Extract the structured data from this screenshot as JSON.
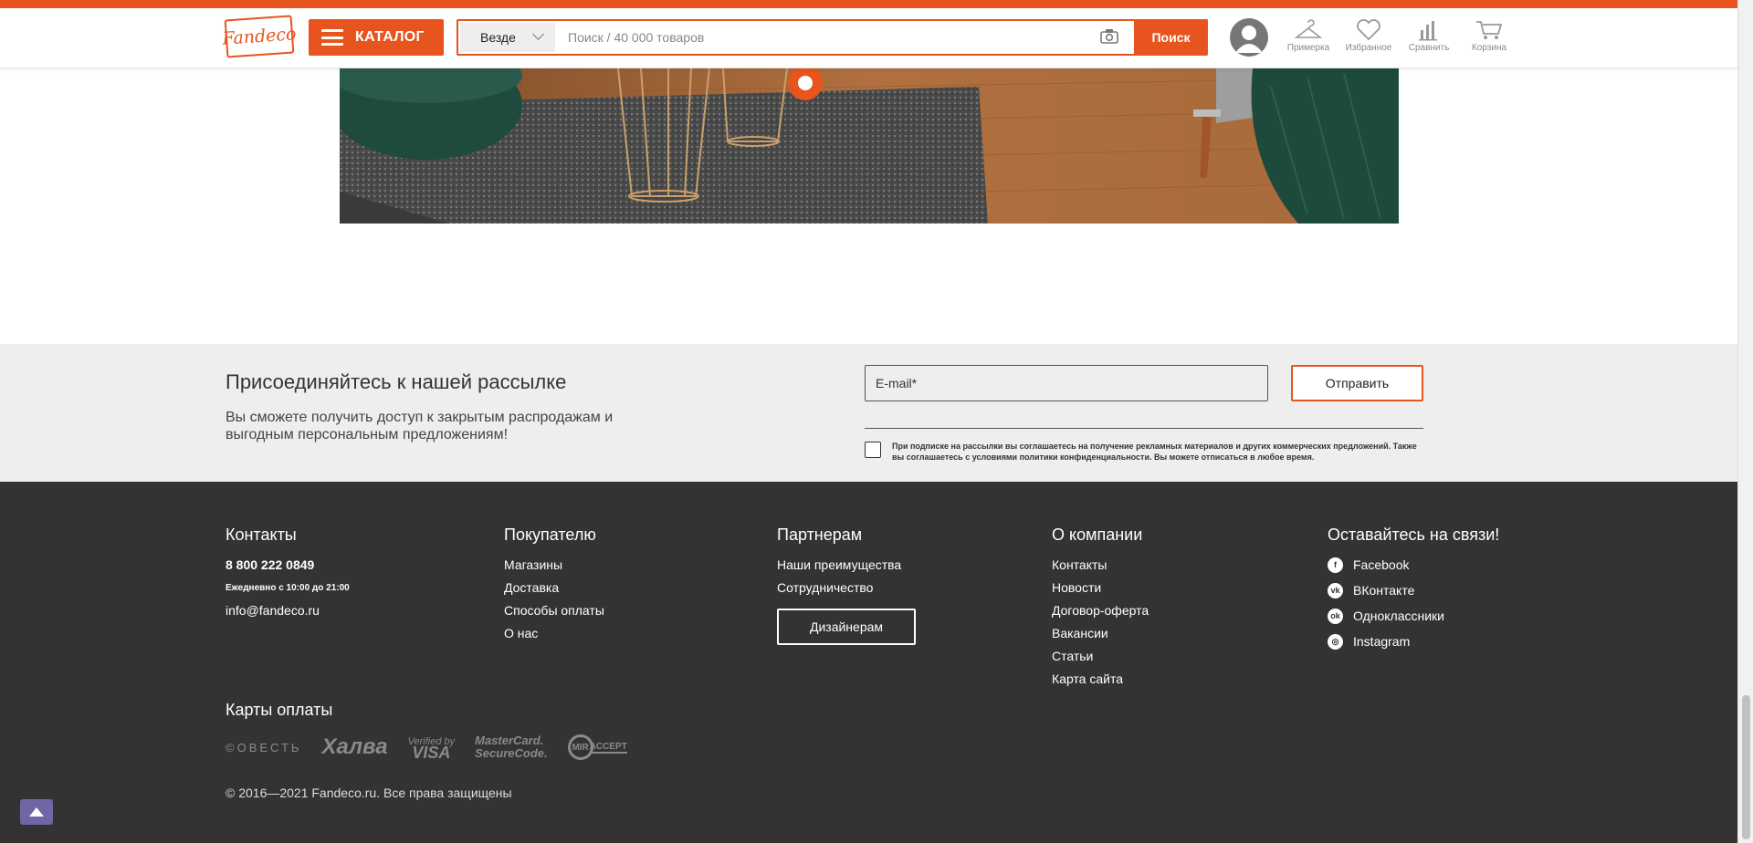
{
  "colors": {
    "accent": "#e8541e",
    "footer_bg": "#333333",
    "newsletter_bg": "#eeeeee",
    "scroll_top_btn": "#7265a6"
  },
  "header": {
    "logo": "Fandeco",
    "catalog_label": "КАТАЛОГ",
    "search_scope": "Везде",
    "search_placeholder": "Поиск / 40 000 товаров",
    "search_button": "Поиск",
    "icons": [
      {
        "name": "hanger-icon",
        "label": "Примерка"
      },
      {
        "name": "heart-icon",
        "label": "Избранное"
      },
      {
        "name": "compare-icon",
        "label": "Сравнить"
      },
      {
        "name": "cart-icon",
        "label": "Корзина"
      }
    ]
  },
  "newsletter": {
    "title": "Присоединяйтесь к нашей рассылке",
    "text": "Вы сможете получить доступ к закрытым распродажам и выгодным персональным предложениям!",
    "email_placeholder": "E-mail*",
    "submit_label": "Отправить",
    "agreement": "При подписке на рассылки вы соглашаетесь на получение рекламных материалов и других коммерческих предложений. Также вы соглашаетесь с условиями политики конфиденциальности. Вы можете отписаться в любое время."
  },
  "footer": {
    "contacts": {
      "title": "Контакты",
      "phone": "8 800 222 0849",
      "hours": "Ежедневно с 10:00 до 21:00",
      "email": "info@fandeco.ru"
    },
    "buyer": {
      "title": "Покупателю",
      "links": [
        "Магазины",
        "Доставка",
        "Способы оплаты",
        "О нас"
      ]
    },
    "partners": {
      "title": "Партнерам",
      "links": [
        "Наши преимущества",
        "Сотрудничество"
      ],
      "designers_button": "Дизайнерам"
    },
    "company": {
      "title": "О компании",
      "links": [
        "Контакты",
        "Новости",
        "Договор-оферта",
        "Вакансии",
        "Статьи",
        "Карта сайта"
      ]
    },
    "social": {
      "title": "Оставайтесь на связи!",
      "links": [
        "Facebook",
        "ВКонтакте",
        "Одноклассники",
        "Instagram"
      ]
    },
    "payment": {
      "title": "Карты оплаты",
      "logos": [
        "©ОВЕСТЬ",
        "Халва",
        "Verified by",
        "VISA",
        "MasterCard.",
        "SecureCode.",
        "MIR",
        "ACCEPT"
      ]
    },
    "copyright": "© 2016—2021 Fandeco.ru. Все права защищены"
  }
}
